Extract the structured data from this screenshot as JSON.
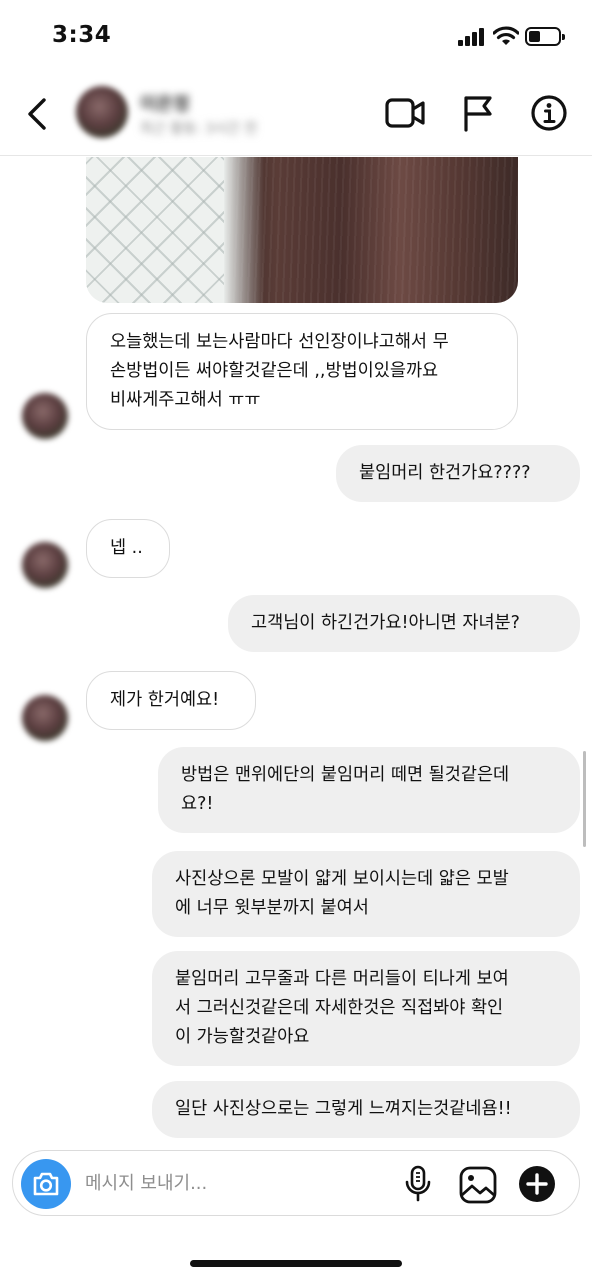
{
  "status_bar": {
    "time": "3:34",
    "battery_level_percent": 40
  },
  "header": {
    "contact_name": "이은정",
    "contact_status": "최근 활동: 3시간 전",
    "icons": [
      "back-icon",
      "video-camera-icon",
      "flag-icon",
      "info-icon"
    ]
  },
  "messages": [
    {
      "id": 1,
      "direction": "incoming",
      "type": "photo",
      "description": ""
    },
    {
      "id": 2,
      "direction": "incoming",
      "text": "오늘했는데 보는사람마다 선인장이냐고해서 무\n손방법이든 써야할것같은데 ,,방법이있을까요\n비싸게주고해서 ㅠㅠ"
    },
    {
      "id": 3,
      "direction": "outgoing",
      "text": "붙임머리 한건가요????"
    },
    {
      "id": 4,
      "direction": "incoming",
      "text": "넵 .."
    },
    {
      "id": 5,
      "direction": "outgoing",
      "text": "고객님이 하긴건가요!아니면 자녀분?"
    },
    {
      "id": 6,
      "direction": "incoming",
      "text": "제가 한거예요!"
    },
    {
      "id": 7,
      "direction": "outgoing",
      "text": "방법은 맨위에단의 붙임머리 떼면 될것같은데\n요?!"
    },
    {
      "id": 8,
      "direction": "outgoing",
      "text": "사진상으론 모발이 얇게 보이시는데 얇은 모발\n에 너무 윗부분까지 붙여서"
    },
    {
      "id": 9,
      "direction": "outgoing",
      "text": "붙임머리 고무줄과 다른 머리들이 티나게 보여\n서 그러신것같은데 자세한것은 직접봐야 확인\n이 가능할것같아요"
    },
    {
      "id": 10,
      "direction": "outgoing",
      "text": "일단 사진상으로는 그렇게 느껴지는것같네욤!!"
    }
  ],
  "composer": {
    "placeholder": "메시지 보내기...",
    "value": "",
    "icons": [
      "camera-icon",
      "microphone-icon",
      "gallery-icon",
      "add-icon"
    ],
    "camera_button_color": "#3897f0"
  },
  "colors": {
    "incoming_bubble": "#ffffff",
    "outgoing_bubble": "#efefef",
    "accent": "#3897f0"
  }
}
